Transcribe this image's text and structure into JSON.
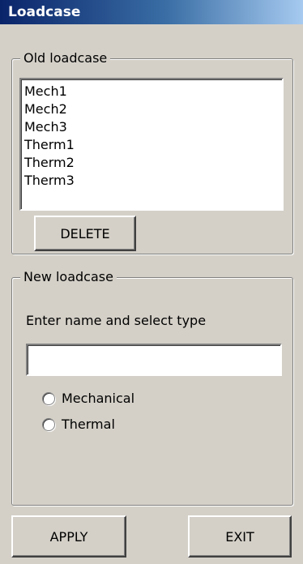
{
  "window": {
    "title": "Loadcase"
  },
  "old_loadcase": {
    "legend": "Old loadcase",
    "items": [
      "Mech1",
      "Mech2",
      "Mech3",
      "Therm1",
      "Therm2",
      "Therm3"
    ],
    "delete_label": "DELETE"
  },
  "new_loadcase": {
    "legend": "New loadcase",
    "instruction": "Enter name and select type",
    "name_value": "",
    "types": [
      "Mechanical",
      "Thermal"
    ]
  },
  "footer": {
    "apply_label": "APPLY",
    "exit_label": "EXIT"
  }
}
